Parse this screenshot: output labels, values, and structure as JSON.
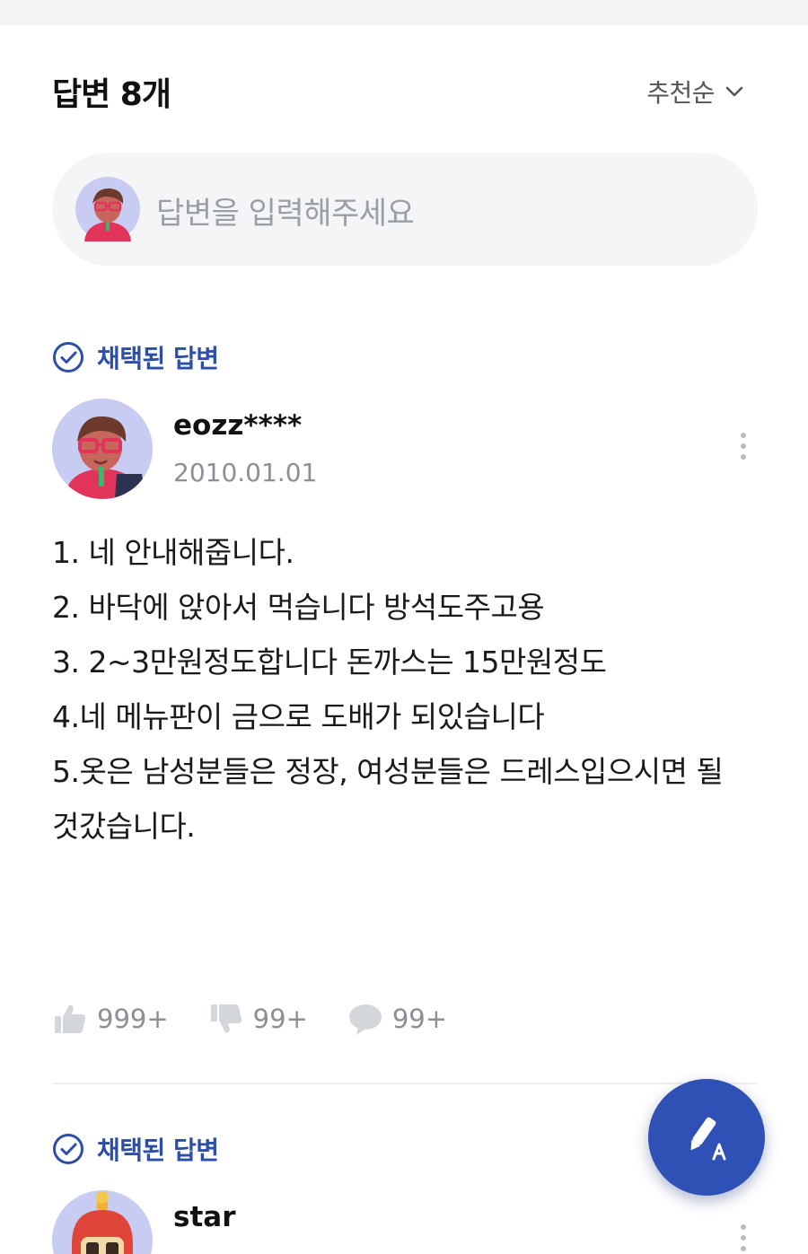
{
  "header": {
    "title": "답변 8개",
    "sort_label": "추천순"
  },
  "answer_input": {
    "placeholder": "답변을 입력해주세요"
  },
  "answers": [
    {
      "badge": "채택된 답변",
      "username": "eozz****",
      "date": "2010.01.01",
      "lines": [
        "1. 네 안내해줍니다.",
        "2. 바닥에 앉아서 먹습니다 방석도주고용",
        "3. 2~3만원정도합니다 돈까스는 15만원정도",
        "4.네 메뉴판이 금으로 도배가 되있습니다",
        "5.옷은 남성분들은 정장, 여성분들은 드레스입으시면 될",
        "것갔습니다."
      ],
      "likes": "999+",
      "dislikes": "99+",
      "comments": "99+"
    },
    {
      "badge": "채택된 답변",
      "username": "star"
    }
  ],
  "colors": {
    "accent": "#2f51b5",
    "badge_text": "#2d4ea8",
    "muted": "#8b8f96"
  },
  "icons": {
    "sort": "chevron-down-icon",
    "badge": "check-circle-icon",
    "more": "more-vertical-icon",
    "like": "thumbs-up-icon",
    "dislike": "thumbs-down-icon",
    "comment": "comment-icon",
    "fab": "pen-write-icon"
  }
}
